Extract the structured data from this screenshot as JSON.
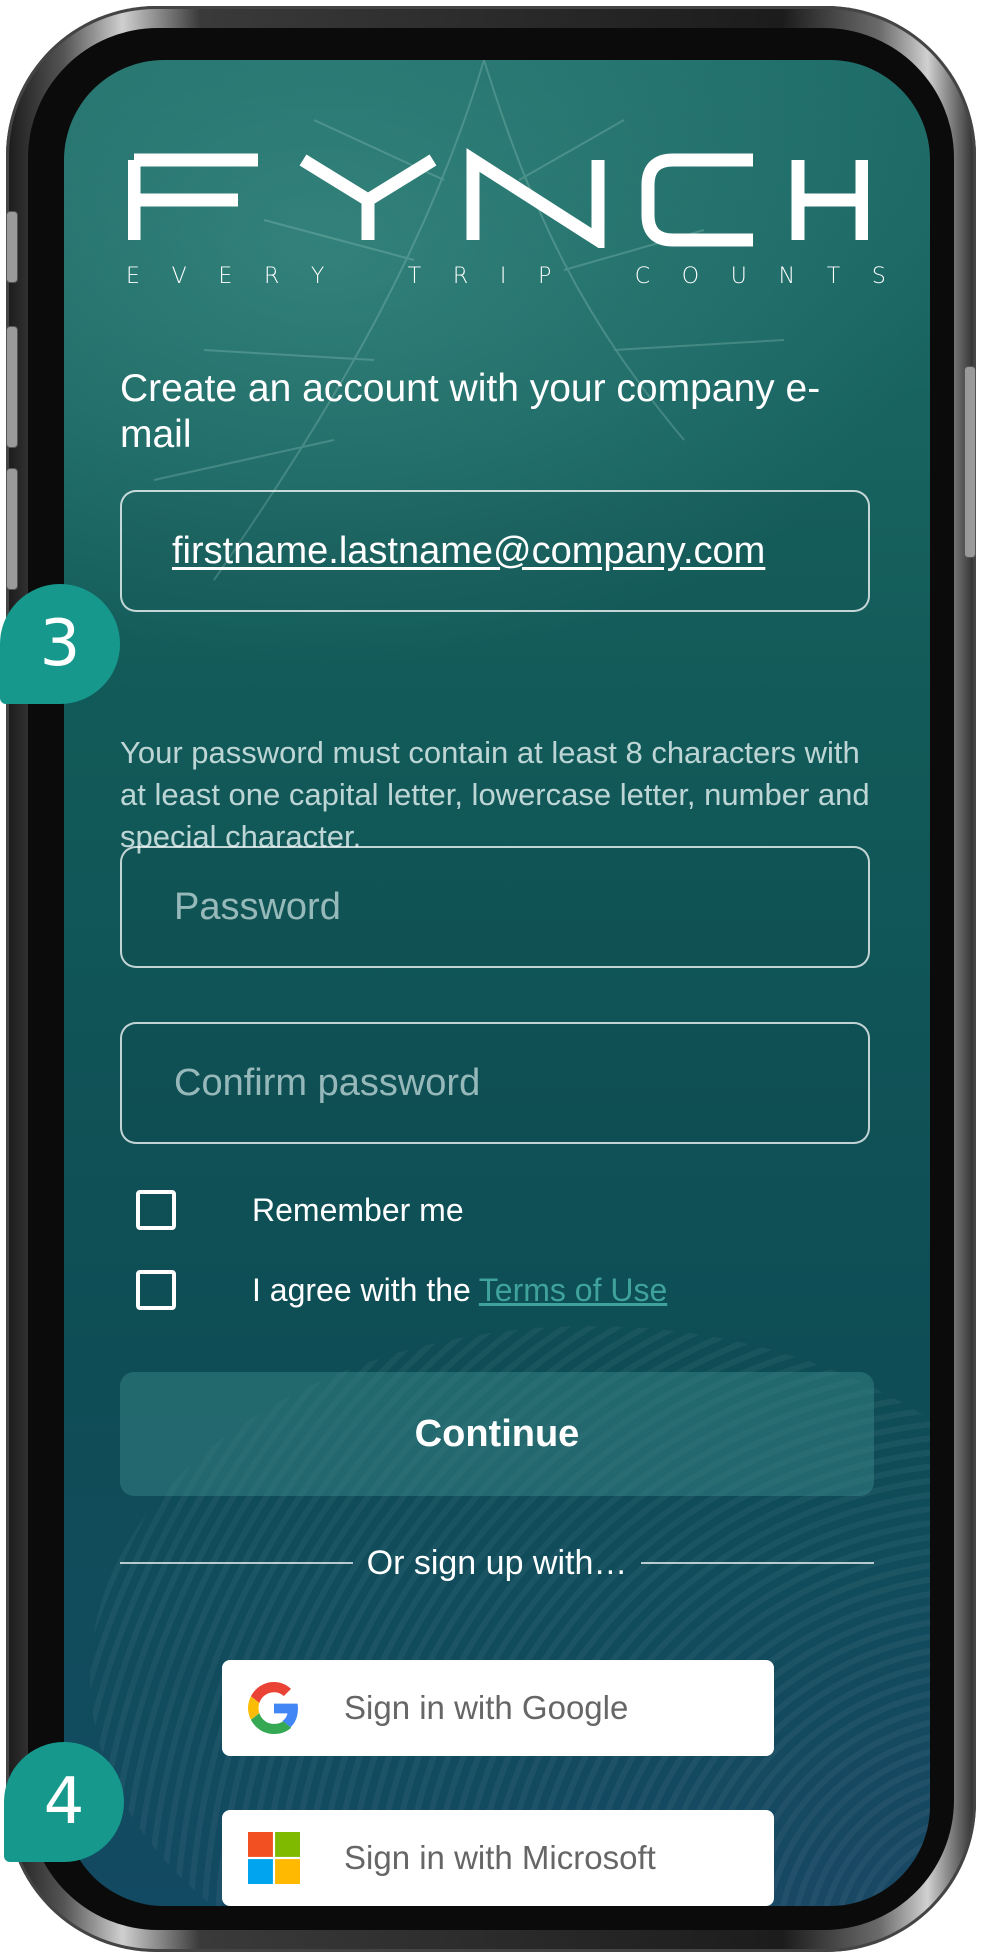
{
  "brand": {
    "logo_text": "FYNCH",
    "tagline_letters": [
      "E",
      "V",
      "E",
      "R",
      "Y",
      "",
      "T",
      "R",
      "I",
      "P",
      "",
      "C",
      "O",
      "U",
      "N",
      "T",
      "S"
    ]
  },
  "signup": {
    "heading": "Create an account with your company e-mail",
    "email_value": "firstname.lastname@company.com",
    "password_hint": "Your password must contain at least 8 characters with at least one capital letter, lowercase letter, number and special character.",
    "password_placeholder": "Password",
    "confirm_placeholder": "Confirm password",
    "remember_label": "Remember me",
    "agree_label": "I agree with the",
    "terms_link": "Terms of Use",
    "continue_label": "Continue",
    "divider_text": "Or sign up with…",
    "google_label": "Sign in with Google",
    "microsoft_label": "Sign in with Microsoft"
  },
  "annotations": {
    "badge_a": "3",
    "badge_b": "4"
  },
  "colors": {
    "accent": "#16998c",
    "link": "#3fa39b",
    "screen_bg": "#125a59"
  },
  "icons": {
    "google": "google-logo-icon",
    "microsoft": "microsoft-logo-icon"
  }
}
